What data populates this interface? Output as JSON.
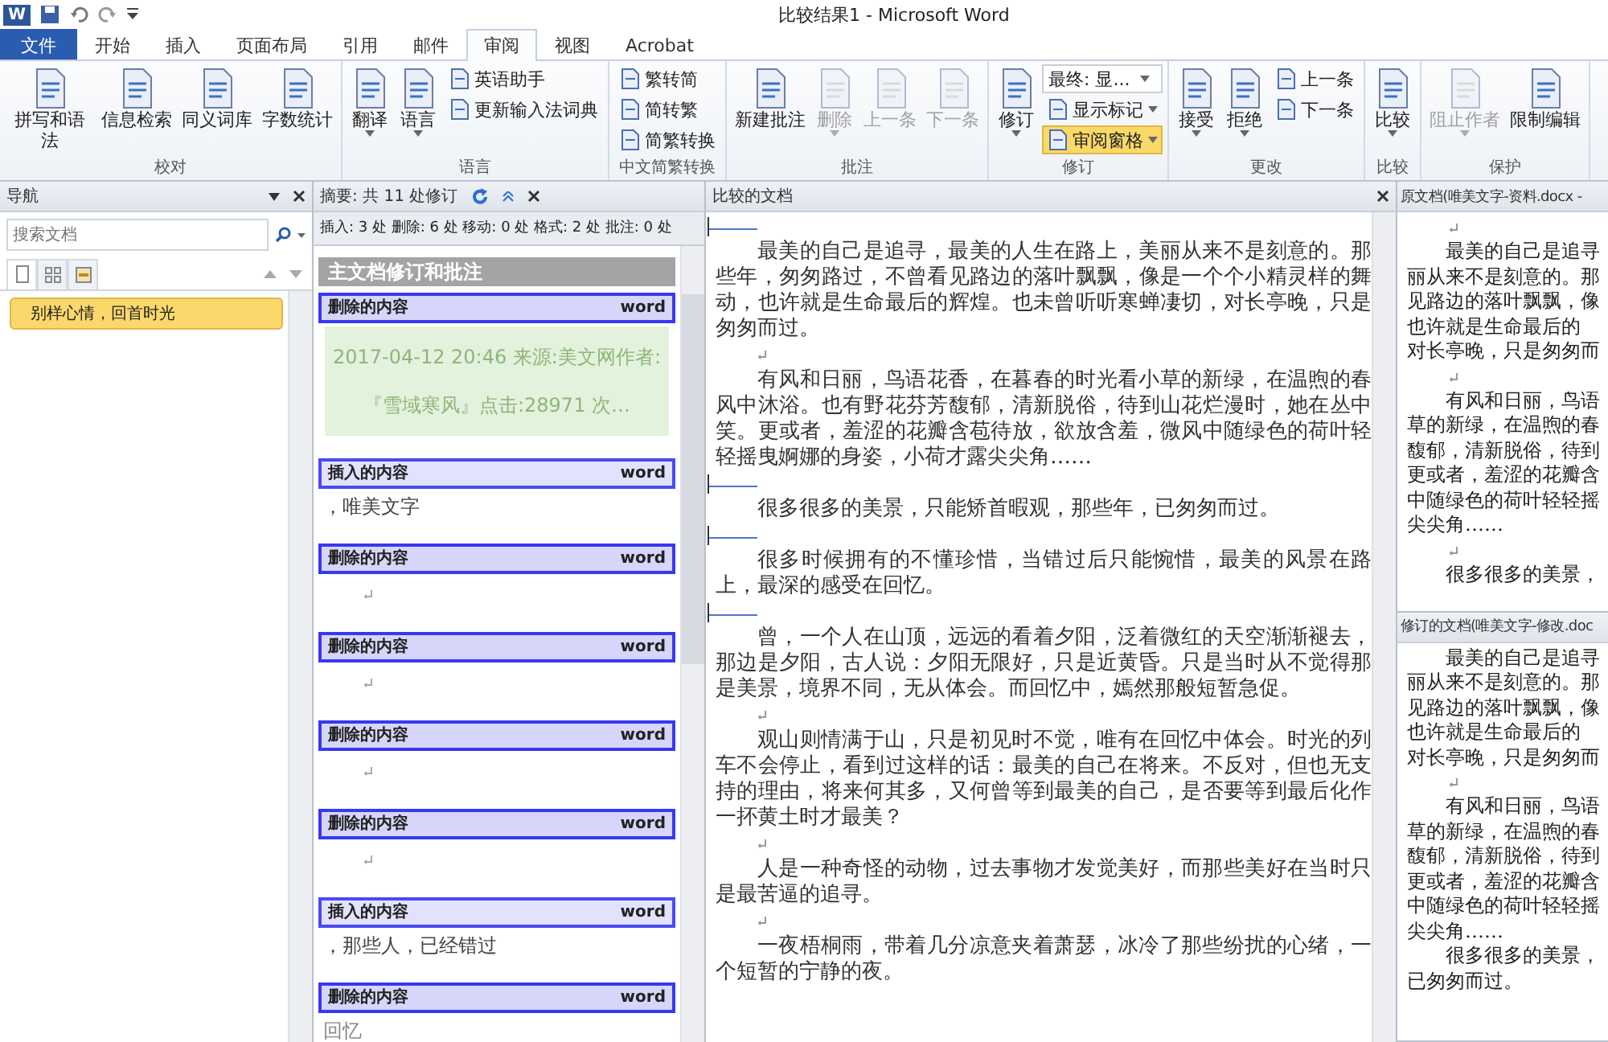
{
  "window": {
    "app_icon": "W",
    "title": "比较结果1 - Microsoft Word"
  },
  "ribbon_tabs": [
    {
      "label": "文件",
      "kind": "file",
      "selected": false
    },
    {
      "label": "开始",
      "kind": "tab",
      "selected": false
    },
    {
      "label": "插入",
      "kind": "tab",
      "selected": false
    },
    {
      "label": "页面布局",
      "kind": "tab",
      "selected": false
    },
    {
      "label": "引用",
      "kind": "tab",
      "selected": false
    },
    {
      "label": "邮件",
      "kind": "tab",
      "selected": false
    },
    {
      "label": "审阅",
      "kind": "tab",
      "selected": true
    },
    {
      "label": "视图",
      "kind": "tab",
      "selected": false
    },
    {
      "label": "Acrobat",
      "kind": "tab",
      "selected": false
    }
  ],
  "ribbon_groups": [
    {
      "label": "校对",
      "items": [
        {
          "label": "拼写和语法",
          "kind": "large",
          "disabled": false,
          "on": false,
          "dropdown": false
        },
        {
          "label": "信息检索",
          "kind": "large",
          "disabled": false,
          "on": false,
          "dropdown": false
        },
        {
          "label": "同义词库",
          "kind": "large",
          "disabled": false,
          "on": false,
          "dropdown": false
        },
        {
          "label": "字数统计",
          "kind": "large",
          "disabled": false,
          "on": false,
          "dropdown": false
        }
      ]
    },
    {
      "label": "语言",
      "items": [
        {
          "label": "翻译",
          "kind": "large",
          "disabled": false,
          "on": false,
          "dropdown": true
        },
        {
          "label": "语言",
          "kind": "large",
          "disabled": false,
          "on": false,
          "dropdown": true
        },
        {
          "label": "英语助手",
          "kind": "small",
          "disabled": false,
          "on": false,
          "dropdown": false
        },
        {
          "label": "更新输入法词典",
          "kind": "small",
          "disabled": false,
          "on": false,
          "dropdown": false
        }
      ]
    },
    {
      "label": "中文简繁转换",
      "items": [
        {
          "label": "繁转简",
          "kind": "small",
          "disabled": false,
          "on": false,
          "dropdown": false
        },
        {
          "label": "简转繁",
          "kind": "small",
          "disabled": false,
          "on": false,
          "dropdown": false
        },
        {
          "label": "简繁转换",
          "kind": "small",
          "disabled": false,
          "on": false,
          "dropdown": false
        }
      ]
    },
    {
      "label": "批注",
      "items": [
        {
          "label": "新建批注",
          "kind": "large",
          "disabled": false,
          "on": false,
          "dropdown": false
        },
        {
          "label": "删除",
          "kind": "large",
          "disabled": true,
          "on": false,
          "dropdown": true
        },
        {
          "label": "上一条",
          "kind": "large",
          "disabled": true,
          "on": false,
          "dropdown": false
        },
        {
          "label": "下一条",
          "kind": "large",
          "disabled": true,
          "on": false,
          "dropdown": false
        }
      ]
    },
    {
      "label": "修订",
      "items": [
        {
          "label": "修订",
          "kind": "large",
          "disabled": false,
          "on": false,
          "dropdown": true
        },
        {
          "label": "最终: 显...",
          "kind": "combo",
          "disabled": false,
          "on": false,
          "dropdown": true
        },
        {
          "label": "显示标记",
          "kind": "small",
          "disabled": false,
          "on": false,
          "dropdown": true
        },
        {
          "label": "审阅窗格",
          "kind": "small",
          "disabled": false,
          "on": true,
          "dropdown": true
        }
      ]
    },
    {
      "label": "更改",
      "items": [
        {
          "label": "接受",
          "kind": "large",
          "disabled": false,
          "on": false,
          "dropdown": true
        },
        {
          "label": "拒绝",
          "kind": "large",
          "disabled": false,
          "on": false,
          "dropdown": true
        },
        {
          "label": "上一条",
          "kind": "small",
          "disabled": false,
          "on": false,
          "dropdown": false
        },
        {
          "label": "下一条",
          "kind": "small",
          "disabled": false,
          "on": false,
          "dropdown": false
        }
      ]
    },
    {
      "label": "比较",
      "items": [
        {
          "label": "比较",
          "kind": "large",
          "disabled": false,
          "on": false,
          "dropdown": true
        }
      ]
    },
    {
      "label": "保护",
      "items": [
        {
          "label": "阻止作者",
          "kind": "large",
          "disabled": true,
          "on": false,
          "dropdown": true
        },
        {
          "label": "限制编辑",
          "kind": "large",
          "disabled": false,
          "on": false,
          "dropdown": false
        }
      ]
    }
  ],
  "navigation": {
    "title": "导航",
    "search": {
      "placeholder": "搜索文档"
    },
    "view_tabs": [
      {
        "selected": true
      },
      {
        "selected": false
      },
      {
        "selected": false
      }
    ],
    "headings": [
      {
        "label": "别样心情，回首时光",
        "selected": true
      }
    ]
  },
  "summary": {
    "title": "摘要: 共 11 处修订",
    "stats": "插入: 3 处 删除: 6 处 移动: 0 处 格式: 2 处 批注: 0 处",
    "section": "主文档修订和批注",
    "revisions": [
      {
        "kind": "deleted",
        "label": "删除的内容",
        "author": "word",
        "highlighted": true,
        "text": "2017-04-12 20:46 来源:美文网作者:『雪域寒风』点击:28971 次…"
      },
      {
        "kind": "inserted",
        "label": "插入的内容",
        "author": "word",
        "highlighted": false,
        "text": "，唯美文字"
      },
      {
        "kind": "deleted",
        "label": "删除的内容",
        "author": "word"
      },
      {
        "kind": "deleted",
        "label": "删除的内容",
        "author": "word"
      },
      {
        "kind": "deleted",
        "label": "删除的内容",
        "author": "word"
      },
      {
        "kind": "deleted",
        "label": "删除的内容",
        "author": "word"
      },
      {
        "kind": "inserted",
        "label": "插入的内容",
        "author": "word",
        "highlighted": false,
        "text": "，那些人，已经错过"
      },
      {
        "kind": "deleted",
        "label": "删除的内容",
        "author": "word",
        "highlighted": false,
        "text": "回忆"
      }
    ]
  },
  "compared_document": {
    "title": "比较的文档",
    "blocks": [
      {
        "kind": "change"
      },
      {
        "kind": "para",
        "text": "最美的自己是追寻，最美的人生在路上，美丽从来不是刻意的。那些年，匆匆路过，不曾看见路边的落叶飘飘，像是一个个小精灵样的舞动，也许就是生命最后的辉煌。也未曾听听寒蝉凄切，对长亭晚，只是匆匆而过。"
      },
      {
        "kind": "blank"
      },
      {
        "kind": "para",
        "text": "有风和日丽，鸟语花香，在暮春的时光看小草的新绿，在温煦的春风中沐浴。也有野花芬芳馥郁，清新脱俗，待到山花烂漫时，她在丛中笑。更或者，羞涩的花瓣含苞待放，欲放含羞，微风中随绿色的荷叶轻轻摇曳婀娜的身姿，小荷才露尖尖角……"
      },
      {
        "kind": "change"
      },
      {
        "kind": "para",
        "text": "很多很多的美景，只能矫首暇观，那些年，已匆匆而过。"
      },
      {
        "kind": "change"
      },
      {
        "kind": "para",
        "text": "很多时候拥有的不懂珍惜，当错过后只能惋惜，最美的风景在路上，最深的感受在回忆。"
      },
      {
        "kind": "change"
      },
      {
        "kind": "para",
        "text": "曾，一个人在山顶，远远的看着夕阳，泛着微红的天空渐渐褪去，那边是夕阳，古人说：夕阳无限好，只是近黄昏。只是当时从不觉得那是美景，境界不同，无从体会。而回忆中，嫣然那般短暂急促。"
      },
      {
        "kind": "blank"
      },
      {
        "kind": "para",
        "text": "观山则情满于山，只是初见时不觉，唯有在回忆中体会。时光的列车不会停止，看到过这样的话：最美的自己在将来。不反对，但也无支持的理由，将来何其多，又何曾等到最美的自己，是否要等到最后化作一抔黄土时才最美？"
      },
      {
        "kind": "blank"
      },
      {
        "kind": "para",
        "text": "人是一种奇怪的动物，过去事物才发觉美好，而那些美好在当时只是最苦逼的追寻。"
      },
      {
        "kind": "blank"
      },
      {
        "kind": "para",
        "text": "一夜梧桐雨，带着几分凉意夹着萧瑟，冰冷了那些纷扰的心绪，一个短暂的宁静的夜。"
      }
    ]
  },
  "original_document": {
    "title": "原文档(唯美文字-资料.docx -",
    "lines": [
      {
        "kind": "blank"
      },
      {
        "kind": "first",
        "text": "最美的自己是追寻"
      },
      {
        "kind": "line",
        "text": "丽从来不是刻意的。那"
      },
      {
        "kind": "line",
        "text": "见路边的落叶飘飘，像"
      },
      {
        "kind": "line",
        "text": "也许就是生命最后的"
      },
      {
        "kind": "line",
        "text": "对长亭晚，只是匆匆而"
      },
      {
        "kind": "blank"
      },
      {
        "kind": "first",
        "text": "有风和日丽，鸟语"
      },
      {
        "kind": "line",
        "text": "草的新绿，在温煦的春"
      },
      {
        "kind": "line",
        "text": "馥郁，清新脱俗，待到"
      },
      {
        "kind": "line",
        "text": "更或者，羞涩的花瓣含"
      },
      {
        "kind": "line",
        "text": "中随绿色的荷叶轻轻摇"
      },
      {
        "kind": "line",
        "text": "尖尖角……"
      },
      {
        "kind": "blank"
      },
      {
        "kind": "first",
        "text": "很多很多的美景，"
      }
    ]
  },
  "revised_document": {
    "title": "修订的文档(唯美文字-修改.doc",
    "lines": [
      {
        "kind": "first",
        "text": "最美的自己是追寻"
      },
      {
        "kind": "line",
        "text": "丽从来不是刻意的。那"
      },
      {
        "kind": "line",
        "text": "见路边的落叶飘飘，像"
      },
      {
        "kind": "line",
        "text": "也许就是生命最后的"
      },
      {
        "kind": "line",
        "text": "对长亭晚，只是匆匆而"
      },
      {
        "kind": "blank"
      },
      {
        "kind": "first",
        "text": "有风和日丽，鸟语"
      },
      {
        "kind": "line",
        "text": "草的新绿，在温煦的春"
      },
      {
        "kind": "line",
        "text": "馥郁，清新脱俗，待到"
      },
      {
        "kind": "line",
        "text": "更或者，羞涩的花瓣含"
      },
      {
        "kind": "line",
        "text": "中随绿色的荷叶轻轻摇"
      },
      {
        "kind": "line",
        "text": "尖尖角……"
      },
      {
        "kind": "first",
        "text": "很多很多的美景，"
      },
      {
        "kind": "line",
        "text": "已匆匆而过。"
      }
    ]
  }
}
